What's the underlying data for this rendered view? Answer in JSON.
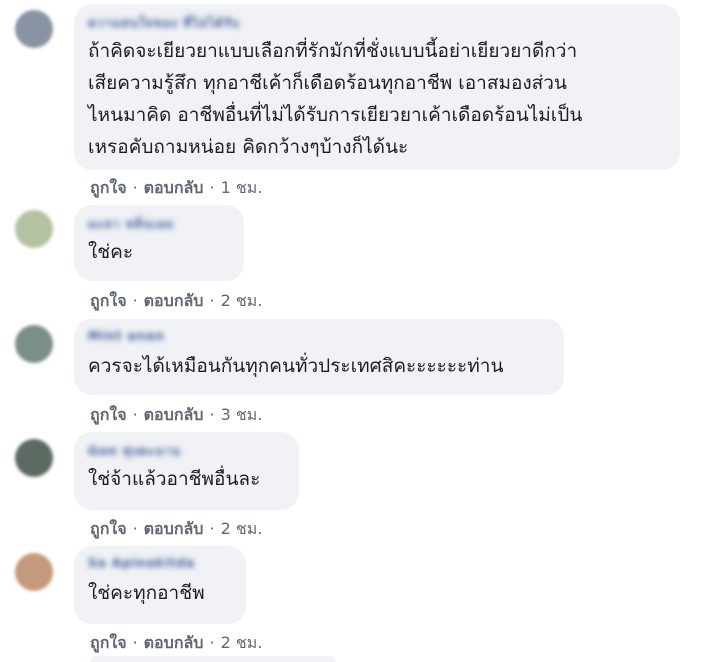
{
  "comments": [
    {
      "author": "ความสนใจของ ที่ไม่ได้รับ",
      "text": "ถ้าคิดจะเยียวยาแบบเลือกที่รักมักที่ชั่งแบบนี้อย่าเยียวยาดีกว่า\nเสียความรู้สึก ทุกอาชีเค้าก็เดือดร้อนทุกอาชีพ เอาสมองส่วน\nไหนมาคิด อาชีพอื่นที่ไม่ได้รับการเยียวยาเค้าเดือดร้อนไม่เป็น\nเหรอคับถามหน่อย คิดกว้างๆบ้างก็ได้นะ",
      "like": "ถูกใจ",
      "reply": "ตอบกลับ",
      "time": "1 ชม.",
      "avatar_color": "#8a93a3"
    },
    {
      "author": "มะลา หลิ่นเอม",
      "text": "ใช่คะ",
      "like": "ถูกใจ",
      "reply": "ตอบกลับ",
      "time": "2 ชม.",
      "avatar_color": "#b5c2a0"
    },
    {
      "author": "Mint anan",
      "text": "ควรจะได้เหมือนกันทุกคนทั่วประเทศสิคะะะะะะท่าน",
      "like": "ถูกใจ",
      "reply": "ตอบกลับ",
      "time": "3 ชม.",
      "avatar_color": "#7a8f86"
    },
    {
      "author": "Gon ทุ่งตะนาน",
      "text": "ใช่จ้าแล้วอาชีพอื่นละ",
      "like": "ถูกใจ",
      "reply": "ตอบกลับ",
      "time": "2 ชม.",
      "avatar_color": "#5d6a62"
    },
    {
      "author": "Sa Apinakitda",
      "text": "ใช่คะทุกอาชีพ",
      "like": "ถูกใจ",
      "reply": "ตอบกลับ",
      "time": "2 ชม.",
      "avatar_color": "#c49a7c"
    }
  ],
  "separator": "·"
}
